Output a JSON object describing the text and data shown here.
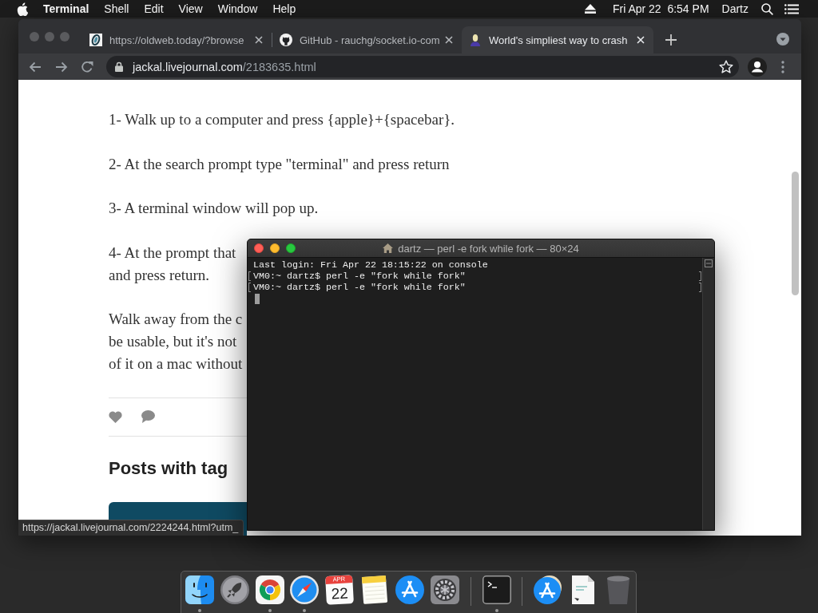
{
  "menu_bar": {
    "app_name": "Terminal",
    "menus": [
      "Shell",
      "Edit",
      "View",
      "Window",
      "Help"
    ],
    "clock": "Fri Apr 22  6:54 PM",
    "user": "Dartz"
  },
  "browser": {
    "focused": false,
    "tabs": [
      {
        "kind": "ring",
        "title": "https://oldweb.today/?browse",
        "selected": false
      },
      {
        "kind": "cat",
        "title": "GitHub - rauchg/socket.io-com",
        "selected": false
      },
      {
        "kind": "person",
        "title": "World's simpliest way to crash",
        "selected": true
      }
    ],
    "address": {
      "host": "jackal.livejournal.com",
      "path": "/2183635.html"
    },
    "page": {
      "paragraphs": [
        {
          "lines": [
            "1- Walk up to a computer and press {apple}+{spacebar}."
          ]
        },
        {
          "lines": [
            "2- At the search prompt type \"terminal\" and press return"
          ]
        },
        {
          "lines": [
            "3- A terminal window will pop up."
          ]
        },
        {
          "lines": [
            "4- At the prompt that",
            "and press return."
          ]
        },
        {
          "lines": [
            "Walk away from the c",
            "be usable, but it's not",
            "of it on a mac without"
          ]
        }
      ],
      "section_title": "Posts with tag",
      "status_url": "https://jackal.livejournal.com/2224244.html?utm_"
    }
  },
  "terminal": {
    "focused": true,
    "title": "dartz — perl -e fork while fork — 80×24",
    "lines": [
      {
        "text": "Last login: Fri Apr 22 18:15:22 on console",
        "marked": false
      },
      {
        "text": "VM0:~ dartz$ perl -e \"fork while fork\"",
        "marked": true
      },
      {
        "text": "VM0:~ dartz$ perl -e \"fork while fork\"",
        "marked": true
      }
    ]
  },
  "dock": {
    "sections": [
      {
        "items": [
          {
            "kind": "finder",
            "running": true
          },
          {
            "kind": "launchpad",
            "running": false
          },
          {
            "kind": "chrome",
            "running": true
          },
          {
            "kind": "safari",
            "running": true
          },
          {
            "kind": "calendar",
            "month": "APR",
            "day": "22",
            "running": false
          },
          {
            "kind": "notes",
            "running": false
          },
          {
            "kind": "app_store",
            "running": false
          },
          {
            "kind": "settings",
            "running": false
          }
        ]
      },
      {
        "items": [
          {
            "kind": "terminal",
            "running": true
          }
        ]
      },
      {
        "items": [
          {
            "kind": "downloads",
            "running": false
          },
          {
            "kind": "document",
            "running": false
          },
          {
            "kind": "trash",
            "running": false
          }
        ]
      }
    ]
  }
}
